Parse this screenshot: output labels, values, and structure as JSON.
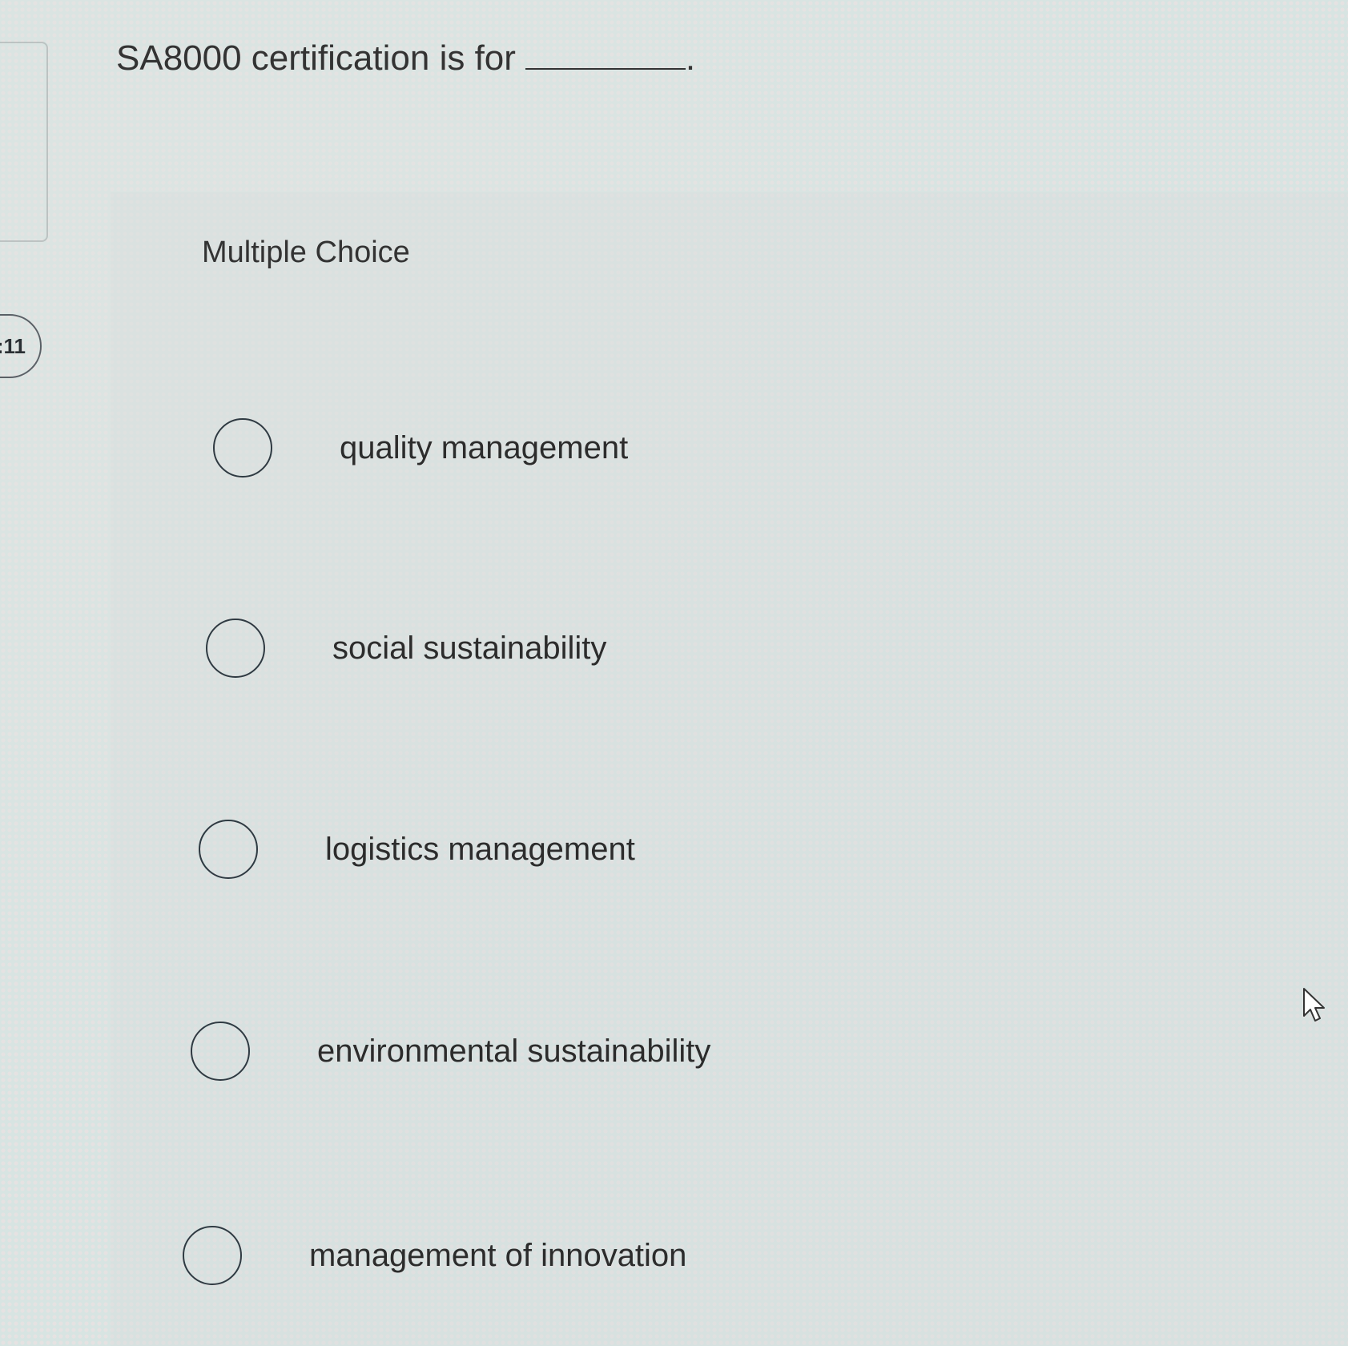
{
  "timer": {
    "label": ":11"
  },
  "question": {
    "text": "SA8000 certification is for",
    "blank_trailing": "."
  },
  "answer_section": {
    "label": "Multiple Choice",
    "options": [
      {
        "label": "quality management",
        "selected": false
      },
      {
        "label": "social sustainability",
        "selected": false
      },
      {
        "label": "logistics management",
        "selected": false
      },
      {
        "label": "environmental sustainability",
        "selected": false
      },
      {
        "label": "management of innovation",
        "selected": false
      }
    ]
  },
  "icons": {
    "radio": "radio-unselected-icon",
    "cursor": "mouse-pointer-icon"
  }
}
